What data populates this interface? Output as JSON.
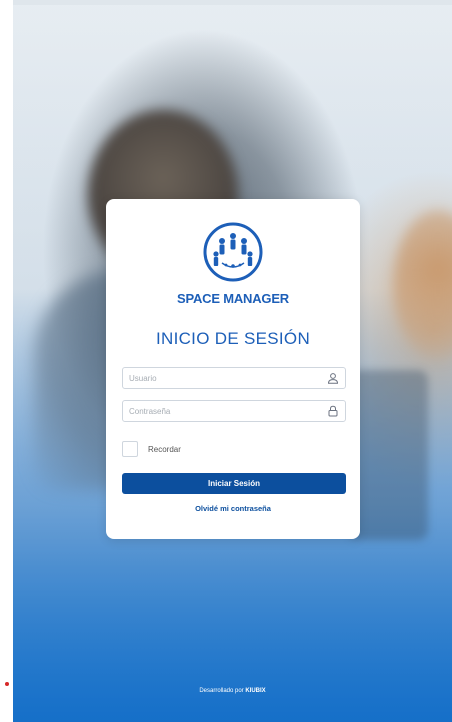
{
  "brand": {
    "name": "SPACE MANAGER",
    "logo_icon": "people-network-icon",
    "color": "#1d5fb8"
  },
  "login": {
    "heading": "INICIO DE SESIÓN",
    "username_placeholder": "Usuario",
    "password_placeholder": "Contraseña",
    "remember_label": "Recordar",
    "submit_label": "Iniciar Sesión",
    "forgot_label": "Olvidé mi contraseña",
    "button_color": "#0c4f9e"
  },
  "footer": {
    "prefix": "Desarrollado por",
    "company": "KIUBIX"
  }
}
